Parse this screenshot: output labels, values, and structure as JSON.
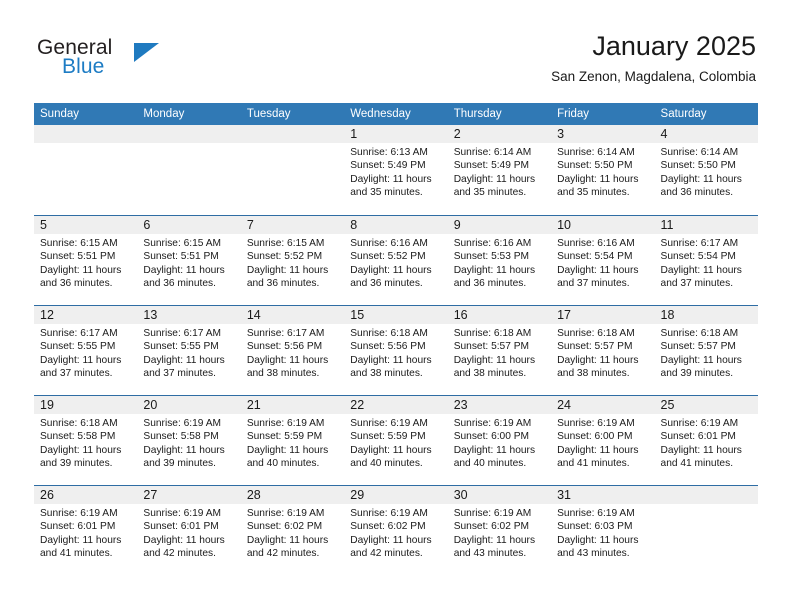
{
  "logo": {
    "text_primary": "General",
    "text_secondary": "Blue",
    "triangle_color": "#1f7ac0",
    "secondary_color": "#1d7cc4"
  },
  "header": {
    "title": "January 2025",
    "subtitle": "San Zenon, Magdalena, Colombia"
  },
  "theme": {
    "header_row_bg": "#3079b5",
    "header_row_text": "#ffffff",
    "week_divider": "#2e6da4",
    "daynum_band_bg": "#efefef",
    "page_bg": "#ffffff",
    "body_text": "#1a1a1a"
  },
  "weekday_headers": [
    "Sunday",
    "Monday",
    "Tuesday",
    "Wednesday",
    "Thursday",
    "Friday",
    "Saturday"
  ],
  "weeks": [
    [
      {
        "day": "",
        "empty": true,
        "lines": []
      },
      {
        "day": "",
        "empty": true,
        "lines": []
      },
      {
        "day": "",
        "empty": true,
        "lines": []
      },
      {
        "day": "1",
        "empty": false,
        "lines": [
          "Sunrise: 6:13 AM",
          "Sunset: 5:49 PM",
          "Daylight: 11 hours",
          "and 35 minutes."
        ]
      },
      {
        "day": "2",
        "empty": false,
        "lines": [
          "Sunrise: 6:14 AM",
          "Sunset: 5:49 PM",
          "Daylight: 11 hours",
          "and 35 minutes."
        ]
      },
      {
        "day": "3",
        "empty": false,
        "lines": [
          "Sunrise: 6:14 AM",
          "Sunset: 5:50 PM",
          "Daylight: 11 hours",
          "and 35 minutes."
        ]
      },
      {
        "day": "4",
        "empty": false,
        "lines": [
          "Sunrise: 6:14 AM",
          "Sunset: 5:50 PM",
          "Daylight: 11 hours",
          "and 36 minutes."
        ]
      }
    ],
    [
      {
        "day": "5",
        "empty": false,
        "lines": [
          "Sunrise: 6:15 AM",
          "Sunset: 5:51 PM",
          "Daylight: 11 hours",
          "and 36 minutes."
        ]
      },
      {
        "day": "6",
        "empty": false,
        "lines": [
          "Sunrise: 6:15 AM",
          "Sunset: 5:51 PM",
          "Daylight: 11 hours",
          "and 36 minutes."
        ]
      },
      {
        "day": "7",
        "empty": false,
        "lines": [
          "Sunrise: 6:15 AM",
          "Sunset: 5:52 PM",
          "Daylight: 11 hours",
          "and 36 minutes."
        ]
      },
      {
        "day": "8",
        "empty": false,
        "lines": [
          "Sunrise: 6:16 AM",
          "Sunset: 5:52 PM",
          "Daylight: 11 hours",
          "and 36 minutes."
        ]
      },
      {
        "day": "9",
        "empty": false,
        "lines": [
          "Sunrise: 6:16 AM",
          "Sunset: 5:53 PM",
          "Daylight: 11 hours",
          "and 36 minutes."
        ]
      },
      {
        "day": "10",
        "empty": false,
        "lines": [
          "Sunrise: 6:16 AM",
          "Sunset: 5:54 PM",
          "Daylight: 11 hours",
          "and 37 minutes."
        ]
      },
      {
        "day": "11",
        "empty": false,
        "lines": [
          "Sunrise: 6:17 AM",
          "Sunset: 5:54 PM",
          "Daylight: 11 hours",
          "and 37 minutes."
        ]
      }
    ],
    [
      {
        "day": "12",
        "empty": false,
        "lines": [
          "Sunrise: 6:17 AM",
          "Sunset: 5:55 PM",
          "Daylight: 11 hours",
          "and 37 minutes."
        ]
      },
      {
        "day": "13",
        "empty": false,
        "lines": [
          "Sunrise: 6:17 AM",
          "Sunset: 5:55 PM",
          "Daylight: 11 hours",
          "and 37 minutes."
        ]
      },
      {
        "day": "14",
        "empty": false,
        "lines": [
          "Sunrise: 6:17 AM",
          "Sunset: 5:56 PM",
          "Daylight: 11 hours",
          "and 38 minutes."
        ]
      },
      {
        "day": "15",
        "empty": false,
        "lines": [
          "Sunrise: 6:18 AM",
          "Sunset: 5:56 PM",
          "Daylight: 11 hours",
          "and 38 minutes."
        ]
      },
      {
        "day": "16",
        "empty": false,
        "lines": [
          "Sunrise: 6:18 AM",
          "Sunset: 5:57 PM",
          "Daylight: 11 hours",
          "and 38 minutes."
        ]
      },
      {
        "day": "17",
        "empty": false,
        "lines": [
          "Sunrise: 6:18 AM",
          "Sunset: 5:57 PM",
          "Daylight: 11 hours",
          "and 38 minutes."
        ]
      },
      {
        "day": "18",
        "empty": false,
        "lines": [
          "Sunrise: 6:18 AM",
          "Sunset: 5:57 PM",
          "Daylight: 11 hours",
          "and 39 minutes."
        ]
      }
    ],
    [
      {
        "day": "19",
        "empty": false,
        "lines": [
          "Sunrise: 6:18 AM",
          "Sunset: 5:58 PM",
          "Daylight: 11 hours",
          "and 39 minutes."
        ]
      },
      {
        "day": "20",
        "empty": false,
        "lines": [
          "Sunrise: 6:19 AM",
          "Sunset: 5:58 PM",
          "Daylight: 11 hours",
          "and 39 minutes."
        ]
      },
      {
        "day": "21",
        "empty": false,
        "lines": [
          "Sunrise: 6:19 AM",
          "Sunset: 5:59 PM",
          "Daylight: 11 hours",
          "and 40 minutes."
        ]
      },
      {
        "day": "22",
        "empty": false,
        "lines": [
          "Sunrise: 6:19 AM",
          "Sunset: 5:59 PM",
          "Daylight: 11 hours",
          "and 40 minutes."
        ]
      },
      {
        "day": "23",
        "empty": false,
        "lines": [
          "Sunrise: 6:19 AM",
          "Sunset: 6:00 PM",
          "Daylight: 11 hours",
          "and 40 minutes."
        ]
      },
      {
        "day": "24",
        "empty": false,
        "lines": [
          "Sunrise: 6:19 AM",
          "Sunset: 6:00 PM",
          "Daylight: 11 hours",
          "and 41 minutes."
        ]
      },
      {
        "day": "25",
        "empty": false,
        "lines": [
          "Sunrise: 6:19 AM",
          "Sunset: 6:01 PM",
          "Daylight: 11 hours",
          "and 41 minutes."
        ]
      }
    ],
    [
      {
        "day": "26",
        "empty": false,
        "lines": [
          "Sunrise: 6:19 AM",
          "Sunset: 6:01 PM",
          "Daylight: 11 hours",
          "and 41 minutes."
        ]
      },
      {
        "day": "27",
        "empty": false,
        "lines": [
          "Sunrise: 6:19 AM",
          "Sunset: 6:01 PM",
          "Daylight: 11 hours",
          "and 42 minutes."
        ]
      },
      {
        "day": "28",
        "empty": false,
        "lines": [
          "Sunrise: 6:19 AM",
          "Sunset: 6:02 PM",
          "Daylight: 11 hours",
          "and 42 minutes."
        ]
      },
      {
        "day": "29",
        "empty": false,
        "lines": [
          "Sunrise: 6:19 AM",
          "Sunset: 6:02 PM",
          "Daylight: 11 hours",
          "and 42 minutes."
        ]
      },
      {
        "day": "30",
        "empty": false,
        "lines": [
          "Sunrise: 6:19 AM",
          "Sunset: 6:02 PM",
          "Daylight: 11 hours",
          "and 43 minutes."
        ]
      },
      {
        "day": "31",
        "empty": false,
        "lines": [
          "Sunrise: 6:19 AM",
          "Sunset: 6:03 PM",
          "Daylight: 11 hours",
          "and 43 minutes."
        ]
      },
      {
        "day": "",
        "empty": true,
        "lines": []
      }
    ]
  ]
}
